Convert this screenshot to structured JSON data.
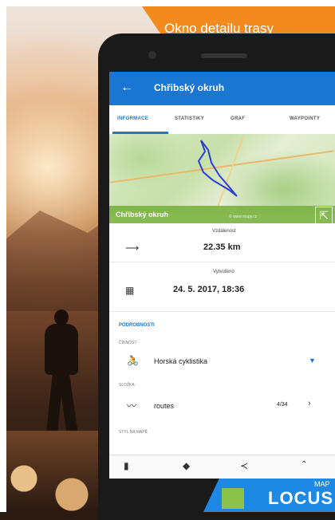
{
  "banner": {
    "text": "Okno detailu trasy"
  },
  "app": {
    "title": "Chřibský okruh"
  },
  "tabs": [
    "INFORMACE",
    "STATISTIKY",
    "GRAF",
    "WAYPOINTY"
  ],
  "map": {
    "title": "Chřibský okruh",
    "attribution": "© www.mapy.cz"
  },
  "stats": {
    "distance_label": "Vzdálenost",
    "distance_value": "22.35 km",
    "created_label": "Vytvořeno",
    "created_value": "24. 5. 2017, 18:36"
  },
  "details": {
    "section_title": "PODROBNOSTI",
    "activity_caption": "ČINNOST",
    "activity_value": "Horská cyklistika",
    "folder_caption": "SLOŽKA",
    "folder_value": "routes",
    "folder_count": "4/34",
    "style_caption": "STYL NA MAPĚ"
  },
  "logo": {
    "word": "LOCUS",
    "map": "MAP"
  },
  "colors": {
    "primary": "#1976d2",
    "accent": "#f28a1e",
    "map_bar": "#7cb342"
  }
}
